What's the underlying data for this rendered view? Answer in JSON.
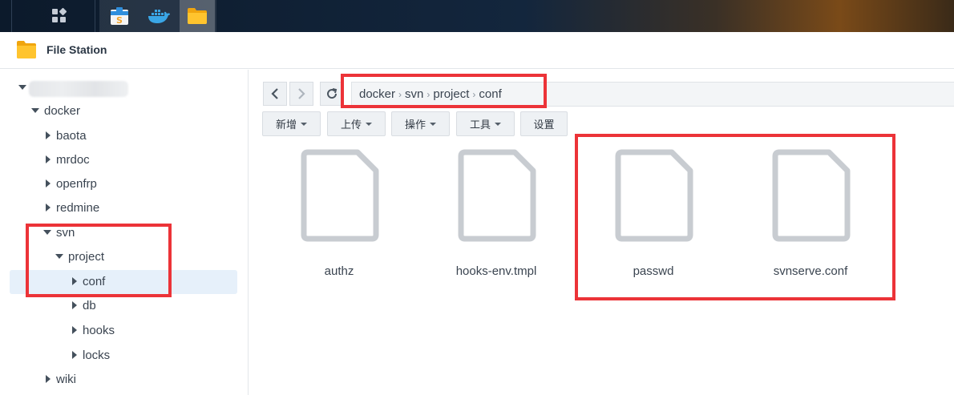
{
  "taskbar": {
    "icons": [
      "main-menu-icon",
      "package-center-icon",
      "docker-icon",
      "file-station-icon"
    ]
  },
  "window": {
    "title": "File Station",
    "icon": "folder-icon"
  },
  "sidebar": {
    "tree": [
      {
        "label": "docker",
        "expanded": true
      },
      {
        "label": "baota",
        "expanded": false
      },
      {
        "label": "mrdoc",
        "expanded": false
      },
      {
        "label": "openfrp",
        "expanded": false
      },
      {
        "label": "redmine",
        "expanded": false
      },
      {
        "label": "svn",
        "expanded": true
      },
      {
        "label": "project",
        "expanded": true
      },
      {
        "label": "conf",
        "expanded": false,
        "selected": true
      },
      {
        "label": "db",
        "expanded": false
      },
      {
        "label": "hooks",
        "expanded": false
      },
      {
        "label": "locks",
        "expanded": false
      },
      {
        "label": "wiki",
        "expanded": false
      }
    ]
  },
  "path": {
    "crumbs": [
      "docker",
      "svn",
      "project",
      "conf"
    ]
  },
  "toolbar": {
    "new_label": "新增",
    "upload_label": "上传",
    "action_label": "操作",
    "tools_label": "工具",
    "settings_label": "设置"
  },
  "files": [
    {
      "name": "authz"
    },
    {
      "name": "hooks-env.tmpl"
    },
    {
      "name": "passwd"
    },
    {
      "name": "svnserve.conf"
    }
  ],
  "colors": {
    "highlight": "#ec3338",
    "selected_row": "#e6f0fa",
    "file_icon": "#c8ccd1"
  }
}
